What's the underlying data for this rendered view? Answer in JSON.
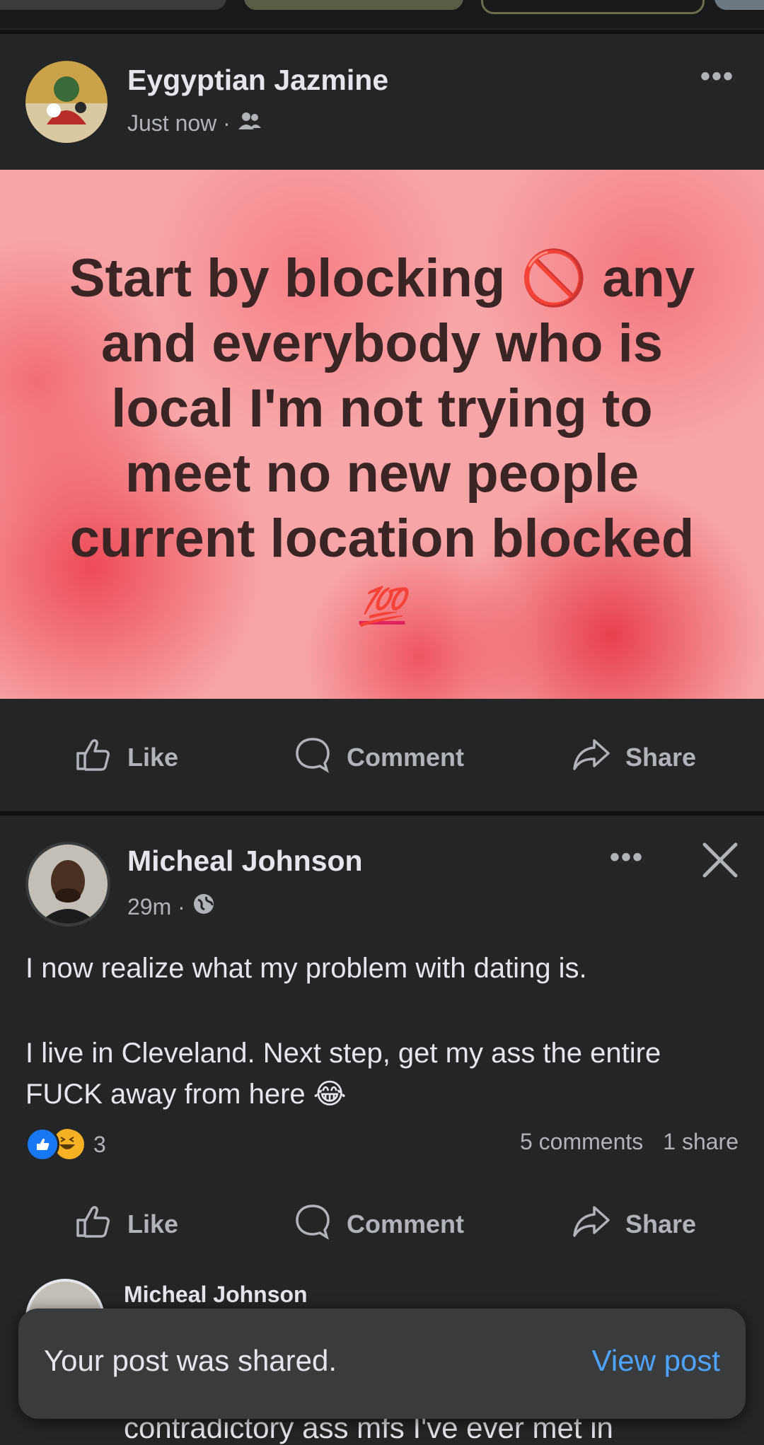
{
  "post1": {
    "author": "Eygyptian Jazmine",
    "time": "Just now ·",
    "privacy_icon": "friends-icon",
    "menu_dots": "•••",
    "bg_text": "Start by blocking 🚫  any and everybody who is local I'm not trying to meet no new people current location blocked",
    "bg_emoji": "💯",
    "like_label": "Like",
    "comment_label": "Comment",
    "share_label": "Share"
  },
  "post2": {
    "author": "Micheal Johnson",
    "time": "29m ·",
    "privacy_icon": "globe-icon",
    "menu_dots": "•••",
    "text_line1": "I now realize what my problem with dating is.",
    "text_line2": "I live in Cleveland. Next step, get my ass the entire FUCK away from here 😂",
    "reaction_count": "3",
    "comments_count": "5 comments",
    "shares_count": "1 share",
    "like_label": "Like",
    "comment_label": "Comment",
    "share_label": "Share"
  },
  "comment_preview": {
    "author": "Micheal Johnson",
    "partial_text": "contradictory ass mfs I've ever met in"
  },
  "toast": {
    "message": "Your post was shared.",
    "action": "View post"
  },
  "colors": {
    "background": "#242526",
    "accent": "#4da3ff",
    "like_blue": "#1877f2"
  }
}
